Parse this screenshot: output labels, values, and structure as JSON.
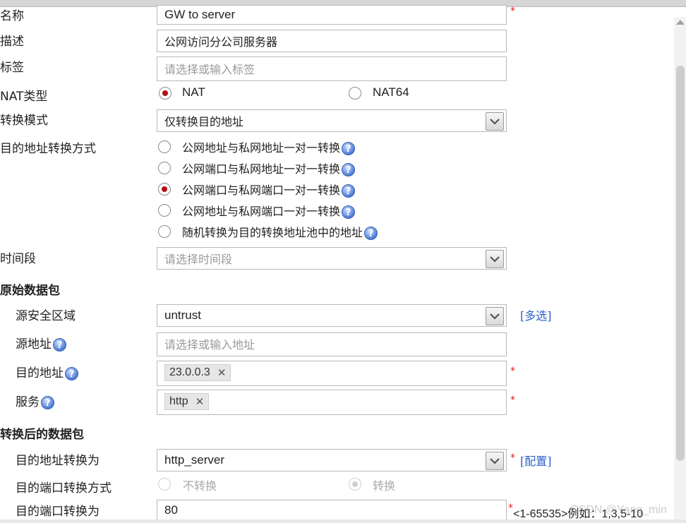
{
  "form": {
    "name": {
      "label": "名称",
      "value": "GW to server"
    },
    "description": {
      "label": "描述",
      "value": "公网访问分公司服务器"
    },
    "tags": {
      "label": "标签",
      "placeholder": "请选择或输入标签"
    },
    "nat_type": {
      "label": "NAT类型",
      "options": [
        "NAT",
        "NAT64"
      ],
      "selected": "NAT"
    },
    "convert_mode": {
      "label": "转换模式",
      "value": "仅转换目的地址"
    },
    "dest_convert_method": {
      "label": "目的地址转换方式",
      "options": [
        "公网地址与私网地址一对一转换",
        "公网端口与私网地址一对一转换",
        "公网端口与私网端口一对一转换",
        "公网地址与私网端口一对一转换",
        "随机转换为目的转换地址池中的地址"
      ],
      "selected_index": 2
    },
    "time_range": {
      "label": "时间段",
      "placeholder": "请选择时间段"
    }
  },
  "original_packet": {
    "title": "原始数据包",
    "source_zone": {
      "label": "源安全区域",
      "value": "untrust",
      "link": "[多选]"
    },
    "source_address": {
      "label": "源地址",
      "placeholder": "请选择或输入地址"
    },
    "dest_address": {
      "label": "目的地址",
      "tags": [
        "23.0.0.3"
      ]
    },
    "service": {
      "label": "服务",
      "tags": [
        "http"
      ]
    }
  },
  "translated_packet": {
    "title": "转换后的数据包",
    "dest_convert_to": {
      "label": "目的地址转换为",
      "value": "http_server",
      "link": "[配置]"
    },
    "port_convert_method": {
      "label": "目的端口转换方式",
      "options": [
        "不转换",
        "转换"
      ],
      "selected": "转换"
    },
    "port_convert_to": {
      "label": "目的端口转换为",
      "value": "80",
      "hint": "<1-65535>例如：1,3,5-10"
    }
  },
  "required_mark": "*",
  "help_glyph": "?",
  "remove_glyph": "✕",
  "watermark": "CSDN @Yang_min",
  "colors": {
    "accent_link": "#2a62c9",
    "required": "#e02020",
    "radio_selected": "#b40f0f"
  }
}
